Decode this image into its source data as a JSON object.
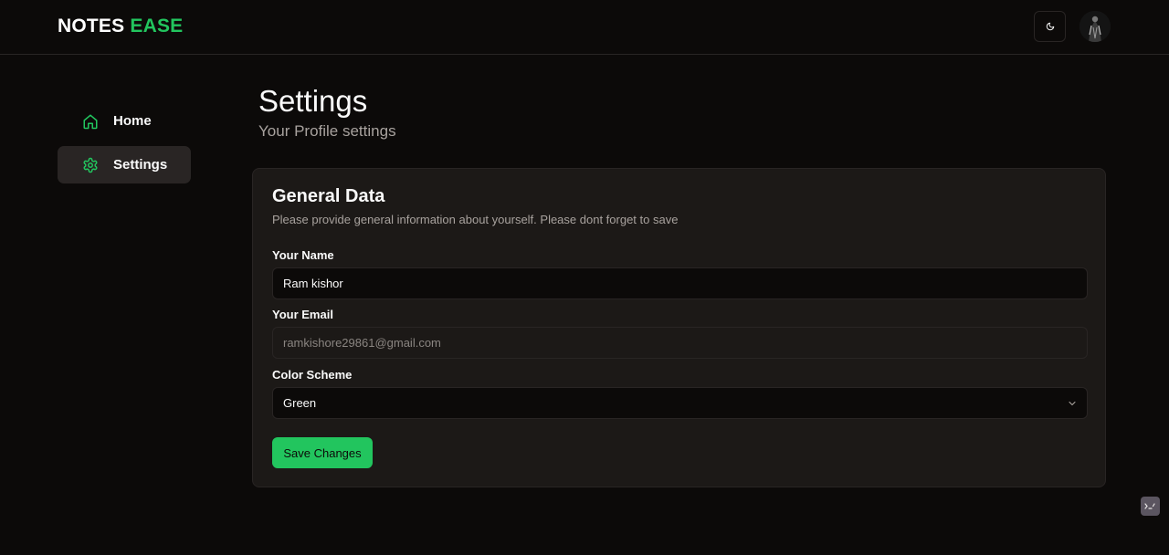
{
  "brand": {
    "part1": "NOTES",
    "part2": "EASE",
    "accent": "#22c55e"
  },
  "header": {
    "theme_toggle_icon": "moon-icon",
    "avatar_icon": "user-avatar"
  },
  "sidebar": {
    "items": [
      {
        "label": "Home",
        "icon": "home-icon",
        "active": false
      },
      {
        "label": "Settings",
        "icon": "gear-icon",
        "active": true
      }
    ]
  },
  "page": {
    "title": "Settings",
    "subtitle": "Your Profile settings"
  },
  "card": {
    "title": "General Data",
    "description": "Please provide general information about yourself. Please dont forget to save",
    "fields": {
      "name": {
        "label": "Your Name",
        "value": "Ram kishor"
      },
      "email": {
        "label": "Your Email",
        "value": "ramkishore29861@gmail.com"
      },
      "color_scheme": {
        "label": "Color Scheme",
        "value": "Green"
      }
    },
    "save_label": "Save Changes"
  },
  "colors": {
    "background": "#0c0a09",
    "card": "#1c1917",
    "border": "#292524",
    "accent": "#22c55e",
    "muted_text": "#a8a29e"
  }
}
